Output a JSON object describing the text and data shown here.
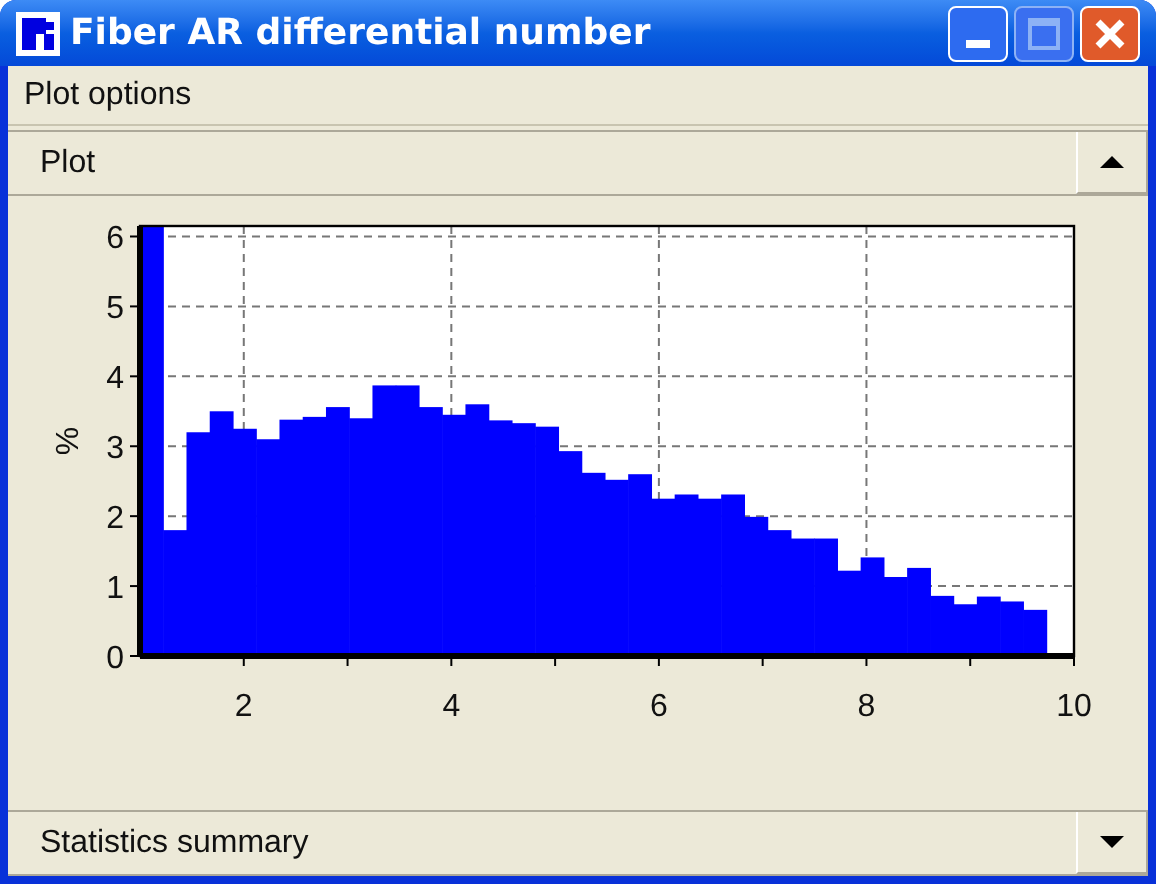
{
  "window": {
    "title": "Fiber AR differential number"
  },
  "menu_bar": {
    "items": [
      {
        "label": "Plot options"
      }
    ]
  },
  "panels": [
    {
      "title": "Plot",
      "expanded": true,
      "chart_data": {
        "type": "bar",
        "ylabel": "%",
        "x": [
          1.112,
          1.336,
          1.56,
          1.784,
          2.008,
          2.232,
          2.456,
          2.68,
          2.904,
          3.128,
          3.352,
          3.576,
          3.8,
          4.024,
          4.248,
          4.472,
          4.696,
          4.92,
          5.144,
          5.368,
          5.592,
          5.816,
          6.04,
          6.264,
          6.488,
          6.712,
          6.936,
          7.16,
          7.384,
          7.608,
          7.832,
          8.056,
          8.28,
          8.504,
          8.728,
          8.952,
          9.176,
          9.4,
          9.624
        ],
        "series": [
          {
            "color": "#0000ff",
            "values": [
              6.15,
              1.8,
              3.2,
              3.5,
              3.25,
              3.1,
              3.38,
              3.42,
              3.56,
              3.4,
              3.87,
              3.87,
              3.56,
              3.45,
              3.6,
              3.37,
              3.33,
              3.28,
              2.93,
              2.62,
              2.52,
              2.6,
              2.25,
              2.31,
              2.25,
              2.31,
              1.99,
              1.8,
              1.68,
              1.68,
              1.22,
              1.41,
              1.13,
              1.26,
              0.86,
              0.74,
              0.85,
              0.78,
              0.66
            ]
          }
        ],
        "xlim": [
          1,
          10
        ],
        "ylim": [
          0,
          6.15
        ],
        "xticks": [
          2,
          4,
          6,
          8,
          10
        ],
        "yticks": [
          0,
          1,
          2,
          3,
          4,
          5,
          6
        ],
        "grid": true
      }
    },
    {
      "title": "Statistics summary",
      "expanded": false
    }
  ]
}
